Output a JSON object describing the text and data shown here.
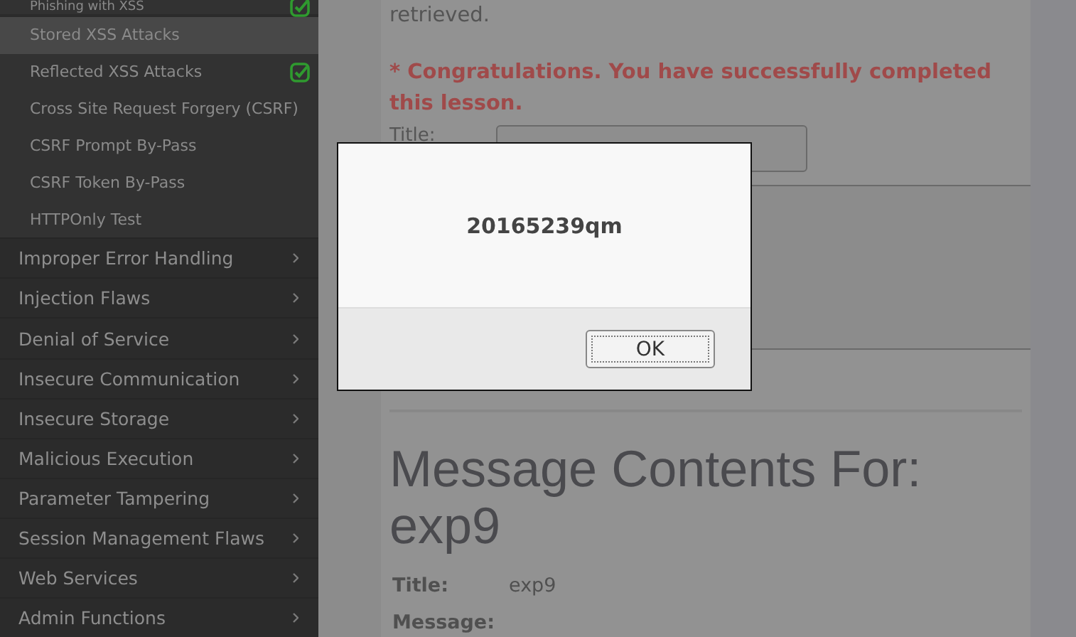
{
  "sidebar": {
    "items": [
      {
        "label": "Phishing with XSS",
        "kind": "sub",
        "selected": false,
        "completed": true
      },
      {
        "label": "Stored XSS Attacks",
        "kind": "sub",
        "selected": true,
        "completed": false
      },
      {
        "label": "Reflected XSS Attacks",
        "kind": "sub",
        "selected": false,
        "completed": true
      },
      {
        "label": "Cross Site Request Forgery (CSRF)",
        "kind": "sub",
        "selected": false,
        "completed": false
      },
      {
        "label": "CSRF Prompt By-Pass",
        "kind": "sub",
        "selected": false,
        "completed": false
      },
      {
        "label": "CSRF Token By-Pass",
        "kind": "sub",
        "selected": false,
        "completed": false
      },
      {
        "label": "HTTPOnly Test",
        "kind": "sub",
        "selected": false,
        "completed": false
      },
      {
        "label": "Improper Error Handling",
        "kind": "category",
        "selected": false
      },
      {
        "label": "Injection Flaws",
        "kind": "category",
        "selected": false
      },
      {
        "label": "Denial of Service",
        "kind": "category",
        "selected": false
      },
      {
        "label": "Insecure Communication",
        "kind": "category",
        "selected": false
      },
      {
        "label": "Insecure Storage",
        "kind": "category",
        "selected": false
      },
      {
        "label": "Malicious Execution",
        "kind": "category",
        "selected": false
      },
      {
        "label": "Parameter Tampering",
        "kind": "category",
        "selected": false
      },
      {
        "label": "Session Management Flaws",
        "kind": "category",
        "selected": false
      },
      {
        "label": "Web Services",
        "kind": "category",
        "selected": false
      },
      {
        "label": "Admin Functions",
        "kind": "category",
        "selected": false
      }
    ]
  },
  "content": {
    "intro_text": "retrieved.",
    "success_message": "* Congratulations. You have successfully completed this lesson.",
    "form": {
      "title_label": "Title:"
    },
    "heading": "Message Contents For: exp9",
    "details": [
      {
        "label": "Title:",
        "value": "exp9"
      },
      {
        "label": "Message:"
      }
    ]
  },
  "dialog": {
    "message": "20165239qm",
    "button": "OK"
  }
}
